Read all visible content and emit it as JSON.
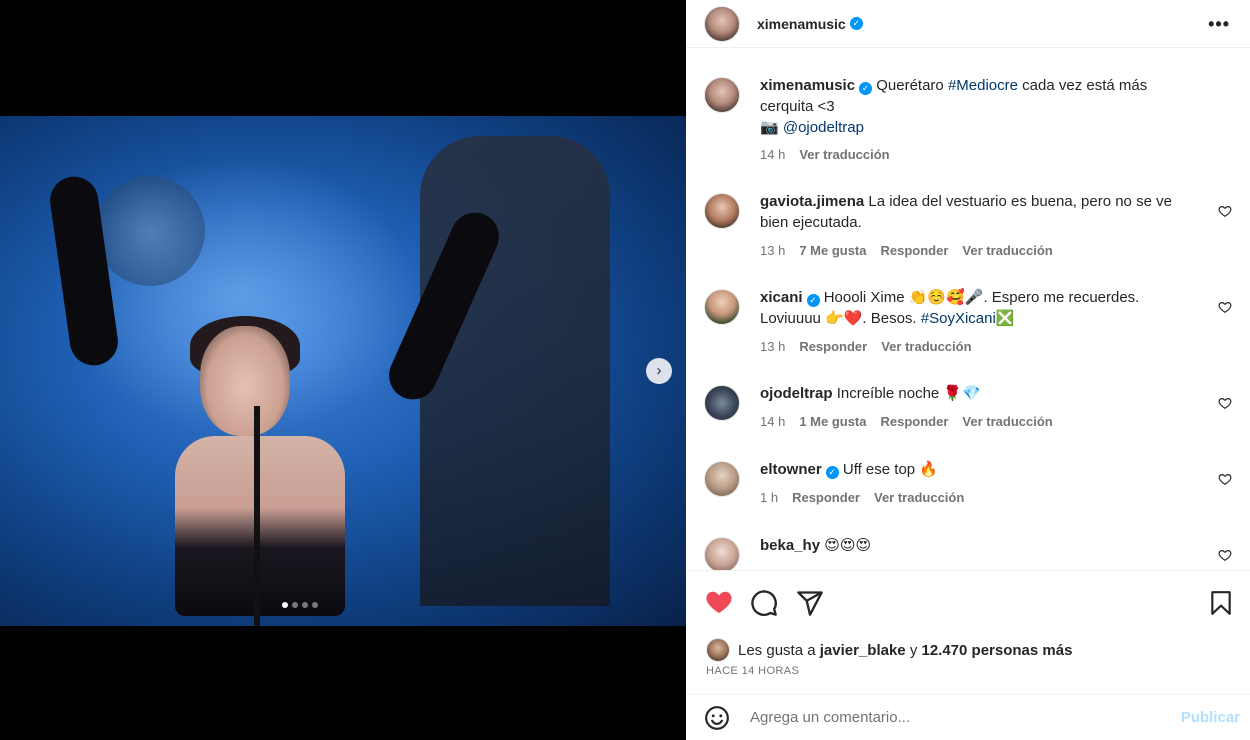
{
  "post": {
    "author": "ximenamusic",
    "slide_count": 4,
    "active_slide": 1
  },
  "caption": {
    "username": "ximenamusic",
    "text_before": "Querétaro ",
    "hashtag": "#Mediocre",
    "text_after": " cada vez está más cerquita <3",
    "camera_glyph": "📷",
    "mention": "@ojodeltrap",
    "time": "14 h",
    "translate": "Ver traducción"
  },
  "comments": [
    {
      "username": "gaviota.jimena",
      "verified": false,
      "text": "La idea del vestuario es buena, pero no se ve bien ejecutada.",
      "time": "13 h",
      "likes": "7 Me gusta",
      "reply": "Responder",
      "translate": "Ver traducción"
    },
    {
      "username": "xicani",
      "verified": true,
      "text": "Hoooli Xime 👏☺️🥰🎤. Espero me recuerdes. Loviuuuu 👉❤️. Besos. ",
      "hashtag": "#SoyXicani",
      "hashtag_suffix": "❎",
      "time": "13 h",
      "likes": "",
      "reply": "Responder",
      "translate": "Ver traducción"
    },
    {
      "username": "ojodeltrap",
      "verified": false,
      "text": "Increíble noche 🌹💎",
      "time": "14 h",
      "likes": "1 Me gusta",
      "reply": "Responder",
      "translate": "Ver traducción"
    },
    {
      "username": "eltowner",
      "verified": true,
      "text": "Uff ese top 🔥",
      "time": "1 h",
      "likes": "",
      "reply": "Responder",
      "translate": "Ver traducción"
    },
    {
      "username": "beka_hy",
      "verified": false,
      "text": "😍😍😍",
      "time": "",
      "likes": "",
      "reply": "",
      "translate": ""
    }
  ],
  "likes_line": {
    "prefix": "Les gusta a ",
    "user": "javier_blake",
    "middle": " y ",
    "count": "12.470 personas más"
  },
  "timestamp": "HACE 14 HORAS",
  "add_comment": {
    "placeholder": "Agrega un comentario...",
    "post_label": "Publicar"
  },
  "icons": {
    "like": "heart-icon",
    "comment": "comment-icon",
    "share": "share-icon",
    "save": "bookmark-icon",
    "more": "more-icon",
    "next": "chevron-right-icon",
    "emoji": "emoji-icon"
  },
  "colors": {
    "like_active": "#ed4956",
    "verified": "#0095f6",
    "link": "#00376b",
    "post_disabled": "#b2dffc"
  },
  "glyphs": {
    "more": "•••",
    "next": "›"
  }
}
